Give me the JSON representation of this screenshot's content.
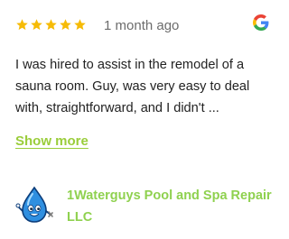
{
  "review": {
    "rating": 5,
    "rating_max": 5,
    "star_icon": "star-icon",
    "time_ago": "1 month ago",
    "source_icon": "google-icon",
    "text": "I was hired to assist in the remodel of a sauna room. Guy, was very easy to deal with, straightforward, and I didn't ...",
    "show_more_label": "Show more"
  },
  "business": {
    "name": "1Waterguys Pool and Spa Repair LLC",
    "avatar_icon": "water-drop-mascot-icon"
  },
  "colors": {
    "star": "#f6bb06",
    "accent": "#8fd14f",
    "time_text": "#6c6c6c",
    "body_text": "#222222"
  }
}
